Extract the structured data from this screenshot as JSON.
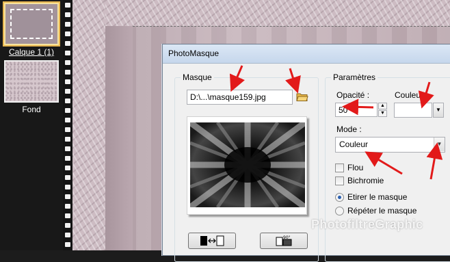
{
  "layers": {
    "items": [
      {
        "label": "Calque 1 (1)",
        "selected": true
      },
      {
        "label": "Fond",
        "selected": false
      }
    ]
  },
  "dialog": {
    "title": "PhotoMasque",
    "masque": {
      "group_title": "Masque",
      "path_value": "D:\\...\\masque159.jpg",
      "open_icon": "folder-open-icon",
      "swap_icon": "swap-mask-icon",
      "rotate_icon": "rotate-90-icon",
      "rotate_badge": "90°"
    },
    "parametres": {
      "group_title": "Paramètres",
      "opacity_label": "Opacité :",
      "opacity_value": "50",
      "color_label": "Couleur :",
      "color_value": "#ffffff",
      "mode_label": "Mode :",
      "mode_value": "Couleur",
      "flou_label": "Flou",
      "flou_checked": false,
      "bichromie_label": "Bichromie",
      "bichromie_checked": false,
      "etirer_label": "Etirer le masque",
      "etirer_selected": true,
      "repeter_label": "Répéter le masque",
      "repeter_selected": false
    }
  },
  "watermark": "PhotofiltreGraphic",
  "colors": {
    "annotation_arrow": "#e21a1a",
    "canvas": "#c7b6bd",
    "titlebar": "#c6d7ec"
  }
}
